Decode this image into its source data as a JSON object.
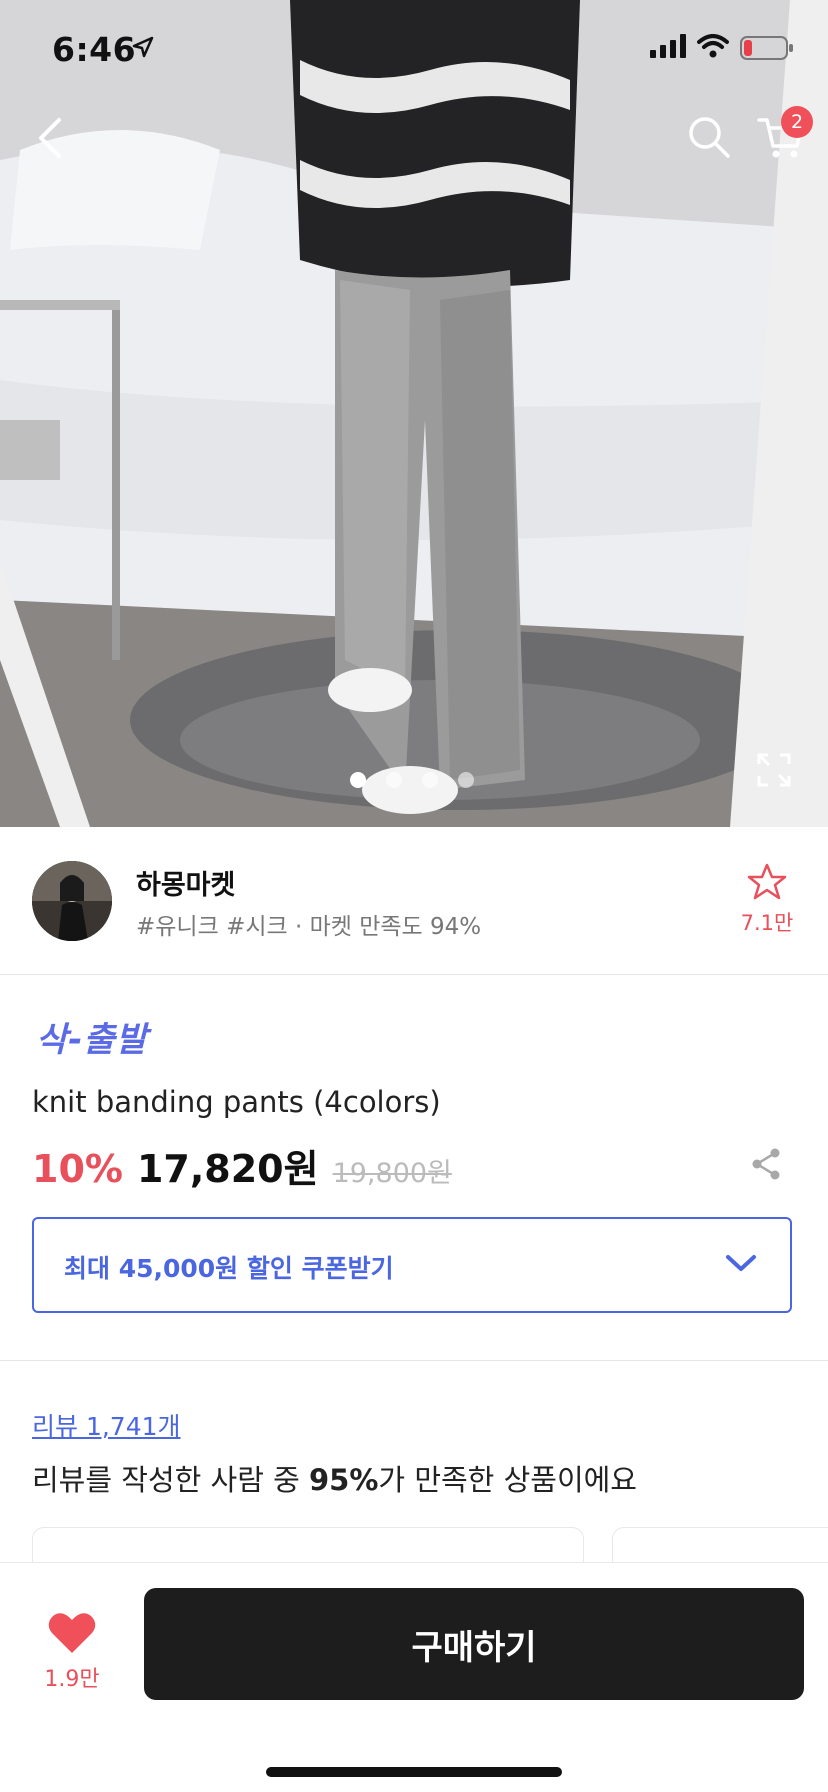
{
  "status_bar": {
    "time": "6:46",
    "cart_badge": "2"
  },
  "hero": {
    "image_count": 4,
    "active_index": 0
  },
  "seller": {
    "name": "하몽마켓",
    "tags": "#유니크 #시크 · 마켓 만족도 94%",
    "favorite_count": "7.1만"
  },
  "product": {
    "promo": "삭-출발",
    "title": "knit banding pants (4colors)",
    "discount": "10%",
    "price": "17,820원",
    "original_price": "19,800원"
  },
  "coupon": {
    "label": "최대 45,000원 할인 쿠폰받기"
  },
  "reviews": {
    "link": "리뷰 1,741개",
    "summary_prefix": "리뷰를 작성한 사람 중 ",
    "summary_percent": "95%",
    "summary_suffix": "가 만족한 상품이에요"
  },
  "bottom_bar": {
    "like_count": "1.9만",
    "buy_label": "구매하기"
  },
  "colors": {
    "accent_red": "#e8505b",
    "accent_blue": "#4a66e0",
    "promo_purple": "#5b6be6",
    "buy_button": "#1d1d1d"
  },
  "icons": [
    "back-icon",
    "search-icon",
    "cart-icon",
    "expand-icon",
    "star-icon",
    "share-icon",
    "chevron-down-icon",
    "heart-icon"
  ]
}
